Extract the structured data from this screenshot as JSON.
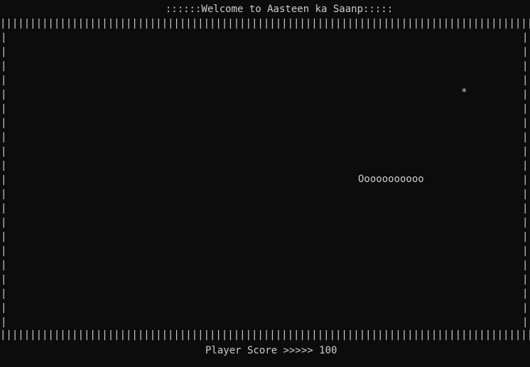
{
  "game": {
    "title": "::::::Welcome to Aasteen ka Saanp:::::",
    "wall_char": "|",
    "food_char": "*",
    "snake_text": "Ooooooooooo",
    "score_label": "Player Score >>>>>",
    "score_value": "100"
  },
  "colors": {
    "background": "#0c0c0c",
    "text": "#cccccc"
  }
}
